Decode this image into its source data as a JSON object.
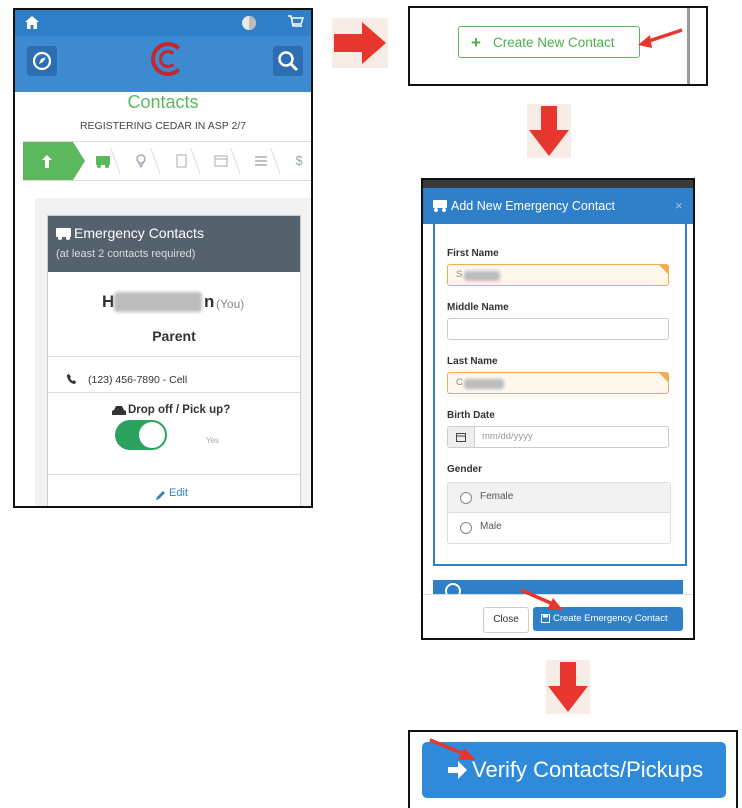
{
  "panel1": {
    "contacts_title": "Contacts",
    "registering": "REGISTERING CEDAR IN ASP 2/7",
    "card_title": "Emergency Contacts",
    "card_sub": "(at least 2 contacts required)",
    "contact_initial": "H",
    "contact_last": "n",
    "you_label": "(You)",
    "role": "Parent",
    "phone": "(123) 456-7890 - Cell",
    "dropoff": "Drop off / Pick up?",
    "toggle_yes": "Yes",
    "edit": "Edit",
    "step_dollar": "$"
  },
  "panel2": {
    "create_label": "Create New Contact"
  },
  "panel3": {
    "modal_title": "Add New Emergency Contact",
    "close_x": "×",
    "first_name_label": "First Name",
    "first_name_value": "S",
    "middle_name_label": "Middle Name",
    "last_name_label": "Last Name",
    "last_name_value": "C",
    "birth_date_label": "Birth Date",
    "birth_placeholder": "mm/dd/yyyy",
    "gender_label": "Gender",
    "gender_options": [
      "Female",
      "Male"
    ],
    "close_button": "Close",
    "create_button": "Create Emergency Contact"
  },
  "panel4": {
    "verify_label": "Verify Contacts/Pickups"
  },
  "colors": {
    "primary_blue": "#2f80c9",
    "green": "#5cb85c",
    "red_arrow": "#e8362f",
    "card_header": "#56616e"
  }
}
